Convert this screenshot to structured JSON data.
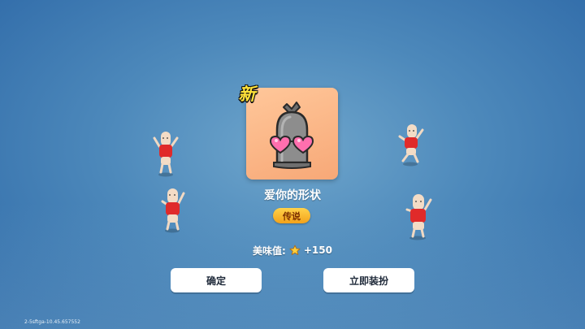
{
  "reward": {
    "new_badge": "新",
    "item_name": "爱你的形状",
    "item_icon": "bell-sack-with-heart-glasses-icon",
    "rarity": "传说",
    "card_color": "#f9b282"
  },
  "taste_value": {
    "label": "美味值:",
    "icon": "star-icon",
    "amount": "+150"
  },
  "buttons": {
    "confirm": "确定",
    "equip_now": "立即装扮"
  },
  "footer": {
    "version": "2-5sftga-10.45.657552"
  },
  "colors": {
    "badge_yellow": "#ffe23a",
    "rarity_gold": "#f3a21a",
    "character_shirt": "#e02a2a"
  }
}
